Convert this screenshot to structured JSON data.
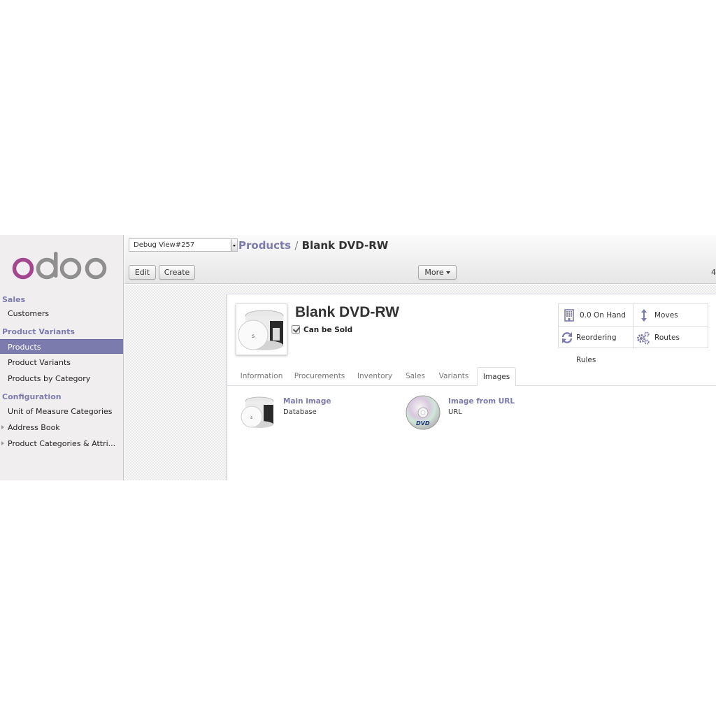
{
  "sidebar": {
    "logo_text": "odoo",
    "sections": [
      {
        "title": "Sales",
        "items": [
          {
            "label": "Customers",
            "active": false,
            "expandable": false
          }
        ]
      },
      {
        "title": "Product Variants",
        "items": [
          {
            "label": "Products",
            "active": true,
            "expandable": false
          },
          {
            "label": "Product Variants",
            "active": false,
            "expandable": false
          },
          {
            "label": "Products by Category",
            "active": false,
            "expandable": false
          }
        ]
      },
      {
        "title": "Configuration",
        "items": [
          {
            "label": "Unit of Measure Categories",
            "active": false,
            "expandable": false
          },
          {
            "label": "Address Book",
            "active": false,
            "expandable": true
          },
          {
            "label": "Product Categories & Attri...",
            "active": false,
            "expandable": true
          }
        ]
      }
    ]
  },
  "header": {
    "debug_select": "Debug View#257",
    "breadcrumb": {
      "parent": "Products",
      "separator": "/",
      "current": "Blank DVD-RW"
    },
    "buttons": {
      "edit": "Edit",
      "create": "Create",
      "more": "More"
    },
    "pager": "4"
  },
  "product": {
    "name": "Blank DVD-RW",
    "can_be_sold_label": "Can be Sold",
    "can_be_sold": true,
    "stat_buttons": {
      "on_hand": {
        "label": "0.0 On Hand",
        "icon": "building-icon"
      },
      "moves": {
        "label": "Moves",
        "icon": "arrows-vertical-icon"
      },
      "reordering": {
        "label": "Reordering Rules",
        "icon": "refresh-icon"
      },
      "routes": {
        "label": "Routes",
        "icon": "gears-icon"
      }
    },
    "tabs": [
      "Information",
      "Procurements",
      "Inventory",
      "Sales",
      "Variants",
      "Images"
    ],
    "active_tab": "Images",
    "images": [
      {
        "title": "Main image",
        "source": "Database"
      },
      {
        "title": "Image from URL",
        "source": "URL"
      }
    ]
  },
  "colors": {
    "accent": "#7c7bad",
    "logo_o": "#a3478f",
    "logo_doo": "#8f8f8f"
  }
}
